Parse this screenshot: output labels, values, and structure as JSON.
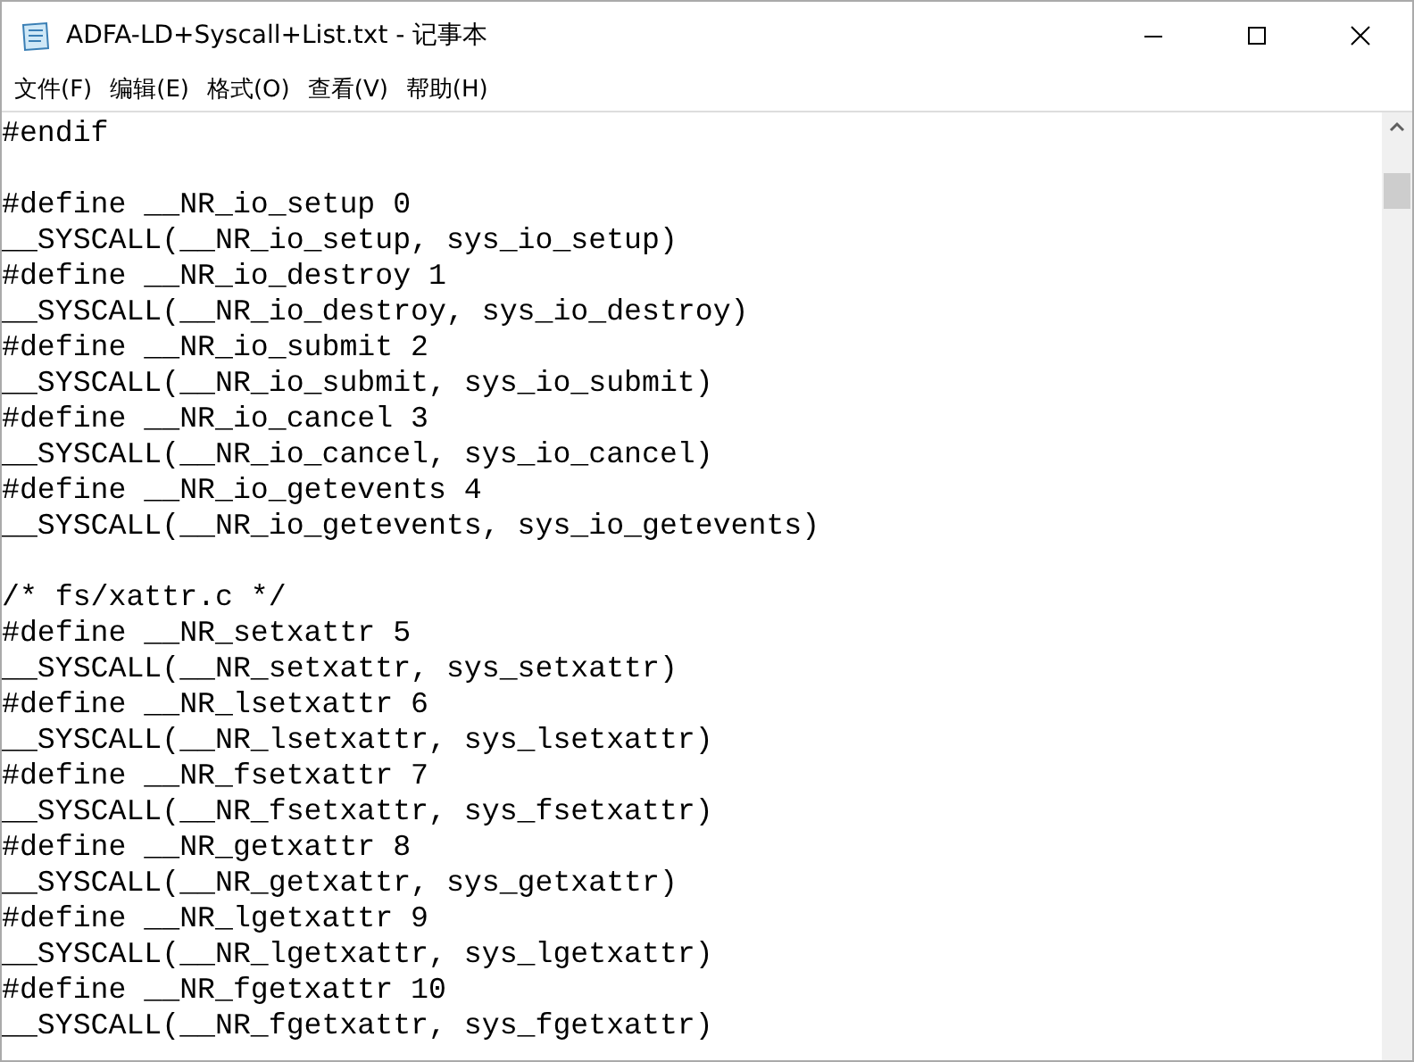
{
  "window": {
    "title": "ADFA-LD+Syscall+List.txt - 记事本"
  },
  "menu": [
    {
      "label": "文件(F)"
    },
    {
      "label": "编辑(E)"
    },
    {
      "label": "格式(O)"
    },
    {
      "label": "查看(V)"
    },
    {
      "label": "帮助(H)"
    }
  ],
  "editor": {
    "lines": [
      {
        "kind": "text",
        "text": "#endif"
      },
      {
        "kind": "blank"
      },
      {
        "kind": "text",
        "text": "#define __NR_io_setup 0"
      },
      {
        "kind": "text",
        "text": "__SYSCALL(__NR_io_setup, sys_io_setup)"
      },
      {
        "kind": "text",
        "text": "#define __NR_io_destroy 1"
      },
      {
        "kind": "text",
        "text": "__SYSCALL(__NR_io_destroy, sys_io_destroy)"
      },
      {
        "kind": "text",
        "text": "#define __NR_io_submit 2"
      },
      {
        "kind": "text",
        "text": "__SYSCALL(__NR_io_submit, sys_io_submit)"
      },
      {
        "kind": "text",
        "text": "#define __NR_io_cancel 3"
      },
      {
        "kind": "text",
        "text": "__SYSCALL(__NR_io_cancel, sys_io_cancel)"
      },
      {
        "kind": "text",
        "text": "#define __NR_io_getevents 4"
      },
      {
        "kind": "text",
        "text": "__SYSCALL(__NR_io_getevents, sys_io_getevents)"
      },
      {
        "kind": "blank"
      },
      {
        "kind": "text",
        "text": "/* fs/xattr.c */"
      },
      {
        "kind": "text",
        "text": "#define __NR_setxattr 5"
      },
      {
        "kind": "text",
        "text": "__SYSCALL(__NR_setxattr, sys_setxattr)"
      },
      {
        "kind": "text",
        "text": "#define __NR_lsetxattr 6"
      },
      {
        "kind": "text",
        "text": "__SYSCALL(__NR_lsetxattr, sys_lsetxattr)"
      },
      {
        "kind": "text",
        "text": "#define __NR_fsetxattr 7"
      },
      {
        "kind": "text",
        "text": "__SYSCALL(__NR_fsetxattr, sys_fsetxattr)"
      },
      {
        "kind": "text",
        "text": "#define __NR_getxattr 8"
      },
      {
        "kind": "text",
        "text": "__SYSCALL(__NR_getxattr, sys_getxattr)"
      },
      {
        "kind": "text",
        "text": "#define __NR_lgetxattr 9"
      },
      {
        "kind": "text",
        "text": "__SYSCALL(__NR_lgetxattr, sys_lgetxattr)"
      },
      {
        "kind": "text",
        "text": "#define __NR_fgetxattr 10"
      },
      {
        "kind": "text",
        "text": "__SYSCALL(__NR_fgetxattr, sys_fgetxattr)"
      }
    ]
  }
}
